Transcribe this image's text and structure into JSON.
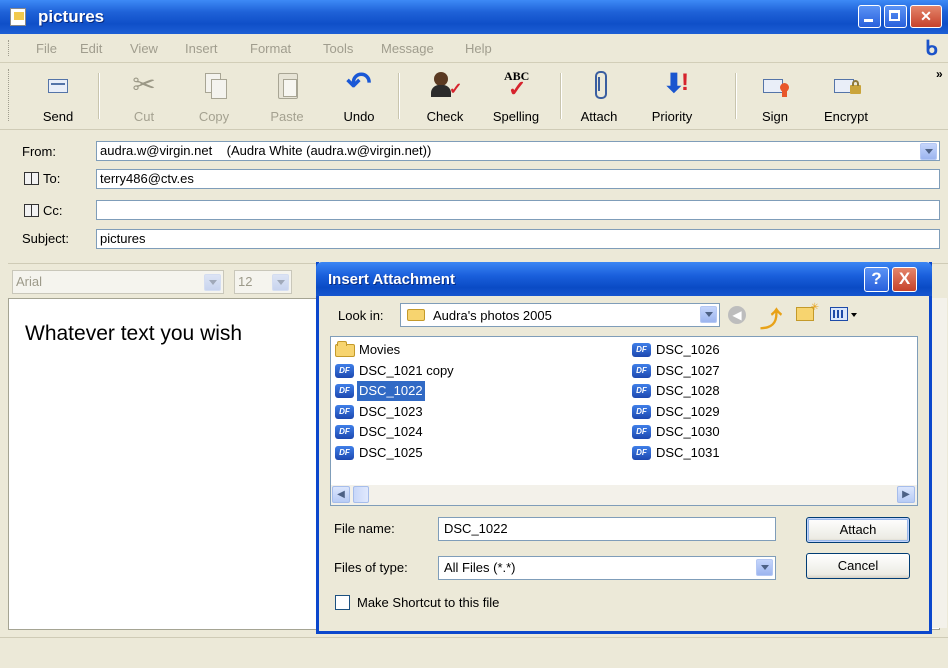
{
  "window": {
    "title": "pictures"
  },
  "menu": [
    "File",
    "Edit",
    "View",
    "Insert",
    "Format",
    "Tools",
    "Message",
    "Help"
  ],
  "toolbar": {
    "send": "Send",
    "cut": "Cut",
    "copy": "Copy",
    "paste": "Paste",
    "undo": "Undo",
    "check": "Check",
    "spelling": "Spelling",
    "attach": "Attach",
    "priority": "Priority",
    "sign": "Sign",
    "encrypt": "Encrypt",
    "overflow": "»"
  },
  "header": {
    "from_label": "From:",
    "from_value": "audra.w@virgin.net    (Audra White (audra.w@virgin.net))",
    "to_label": "To:",
    "to_value": "terry486@ctv.es",
    "cc_label": "Cc:",
    "cc_value": "",
    "subject_label": "Subject:",
    "subject_value": "pictures"
  },
  "format": {
    "font": "Arial",
    "size": "12"
  },
  "body": {
    "text": "Whatever text you wish"
  },
  "dialog": {
    "title": "Insert Attachment",
    "help": "?",
    "close": "X",
    "look_in_label": "Look in:",
    "look_in_value": "Audra's photos 2005",
    "files_col1": [
      "Movies",
      "DSC_1021 copy",
      "DSC_1022",
      "DSC_1023",
      "DSC_1024",
      "DSC_1025"
    ],
    "files_col2": [
      "DSC_1026",
      "DSC_1027",
      "DSC_1028",
      "DSC_1029",
      "DSC_1030",
      "DSC_1031"
    ],
    "selected": "DSC_1022",
    "file_name_label": "File name:",
    "file_name_value": "DSC_1022",
    "files_of_type_label": "Files of type:",
    "files_of_type_value": "All Files (*.*)",
    "attach_button": "Attach",
    "cancel_button": "Cancel",
    "shortcut_label": "Make Shortcut to this file",
    "pdf_badge": "DF"
  },
  "colors": {
    "title_blue": "#0f4fc8",
    "selection": "#316ac5",
    "desktop": "#e2510f"
  }
}
